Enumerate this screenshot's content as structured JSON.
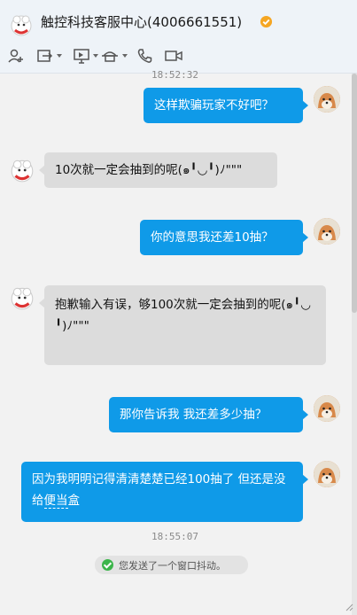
{
  "header": {
    "title": "触控科技客服中心(4006661551)",
    "icons": [
      "mascot-avatar-icon",
      "verified-badge-icon",
      "add-user-icon",
      "share-icon",
      "remote-desktop-icon",
      "assist-icon",
      "phone-icon",
      "video-icon"
    ]
  },
  "chat": {
    "top_time": "18:52:32",
    "messages": [
      {
        "side": "out",
        "text": "这样欺骗玩家不好吧？"
      },
      {
        "side": "in",
        "text": "10次就一定会抽到的呢(๑╹◡╹)ﾉ\"\"\""
      },
      {
        "side": "out",
        "text": "你的意思我还差10抽？"
      },
      {
        "side": "in",
        "text": "抱歉输入有误，够100次就一定会抽到的呢(๑╹◡╹)ﾉ\"\"\""
      },
      {
        "side": "out",
        "text": "那你告诉我 我还差多少抽？"
      },
      {
        "side": "out",
        "text_main": "因为我明明记得清清楚楚已经100抽了 但还是没给",
        "text_tail": "便当",
        "text_end": "盒"
      }
    ],
    "bottom_time": "18:55:07",
    "notice": "您发送了一个窗口抖动。"
  },
  "colors": {
    "outgoing_bubble": "#0f9ae8",
    "incoming_bubble": "#dcdcdc",
    "verified_badge": "#f5a623",
    "notice_check": "#3bb54a"
  }
}
